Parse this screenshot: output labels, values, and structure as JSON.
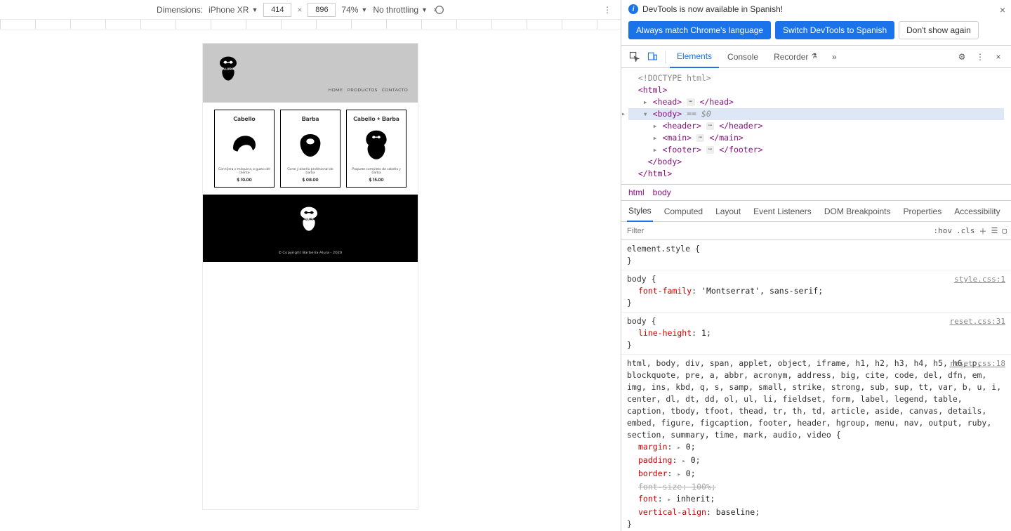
{
  "toolbar": {
    "dimensions_label": "Dimensions:",
    "device": "iPhone XR",
    "width": "414",
    "height": "896",
    "zoom": "74%",
    "throttling": "No throttling"
  },
  "site": {
    "brand": "ALURA",
    "nav": [
      "HOME",
      "PRODUCTOS",
      "CONTACTO"
    ],
    "cards": [
      {
        "title": "Cabello",
        "desc": "Con tijera o máquina, a gusto del cliente",
        "price": "$ 10.00"
      },
      {
        "title": "Barba",
        "desc": "Corte y diseño profesional de barba",
        "price": "$ 08.00"
      },
      {
        "title": "Cabello + Barba",
        "desc": "Paquete completo de cabello y barba",
        "price": "$ 15.00"
      }
    ],
    "copyright": "© Copyright Barbería Alura - 2020"
  },
  "devtools": {
    "info_message": "DevTools is now available in Spanish!",
    "btn_match": "Always match Chrome's language",
    "btn_switch": "Switch DevTools to Spanish",
    "btn_dont": "Don't show again",
    "tabs": {
      "elements": "Elements",
      "console": "Console",
      "recorder": "Recorder"
    },
    "dom": {
      "doctype": "<!DOCTYPE html>",
      "html_open": "<html>",
      "head": {
        "open": "<head>",
        "close": "</head>"
      },
      "body_open": "<body>",
      "body_eq": " == $0",
      "header": {
        "open": "<header>",
        "close": "</header>"
      },
      "main": {
        "open": "<main>",
        "close": "</main>"
      },
      "footer": {
        "open": "<footer>",
        "close": "</footer>"
      },
      "body_close": "</body>",
      "html_close": "</html>"
    },
    "breadcrumb": [
      "html",
      "body"
    ],
    "styles_tabs": [
      "Styles",
      "Computed",
      "Layout",
      "Event Listeners",
      "DOM Breakpoints",
      "Properties",
      "Accessibility"
    ],
    "filter_placeholder": "Filter",
    "filter_tools": {
      "hov": ":hov",
      "cls": ".cls"
    },
    "rules": [
      {
        "selector": "element.style",
        "src": "",
        "props": []
      },
      {
        "selector": "body",
        "src": "style.css:1",
        "props": [
          {
            "name": "font-family",
            "value": "'Montserrat', sans-serif"
          }
        ]
      },
      {
        "selector": "body",
        "src": "reset.css:31",
        "props": [
          {
            "name": "line-height",
            "value": "1"
          }
        ]
      },
      {
        "selector": "html, body, div, span, applet, object, iframe, h1, h2, h3, h4, h5, h6, p, blockquote, pre, a, abbr, acronym, address, big, cite, code, del, dfn, em, img, ins, kbd, q, s, samp, small, strike, strong, sub, sup, tt, var, b, u, i, center, dl, dt, dd, ol, ul, li, fieldset, form, label, legend, table, caption, tbody, tfoot, thead, tr, th, td, article, aside, canvas, details, embed, figure, figcaption, footer, header, hgroup, menu, nav, output, ruby, section, summary, time, mark, audio, video",
        "src": "reset.css:18",
        "props": [
          {
            "name": "margin",
            "value": "0",
            "caret": true
          },
          {
            "name": "padding",
            "value": "0",
            "caret": true
          },
          {
            "name": "border",
            "value": "0",
            "caret": true
          },
          {
            "name": "font-size",
            "value": "100%",
            "strike": true
          },
          {
            "name": "font",
            "value": "inherit",
            "caret": true
          },
          {
            "name": "vertical-align",
            "value": "baseline"
          }
        ]
      }
    ]
  }
}
